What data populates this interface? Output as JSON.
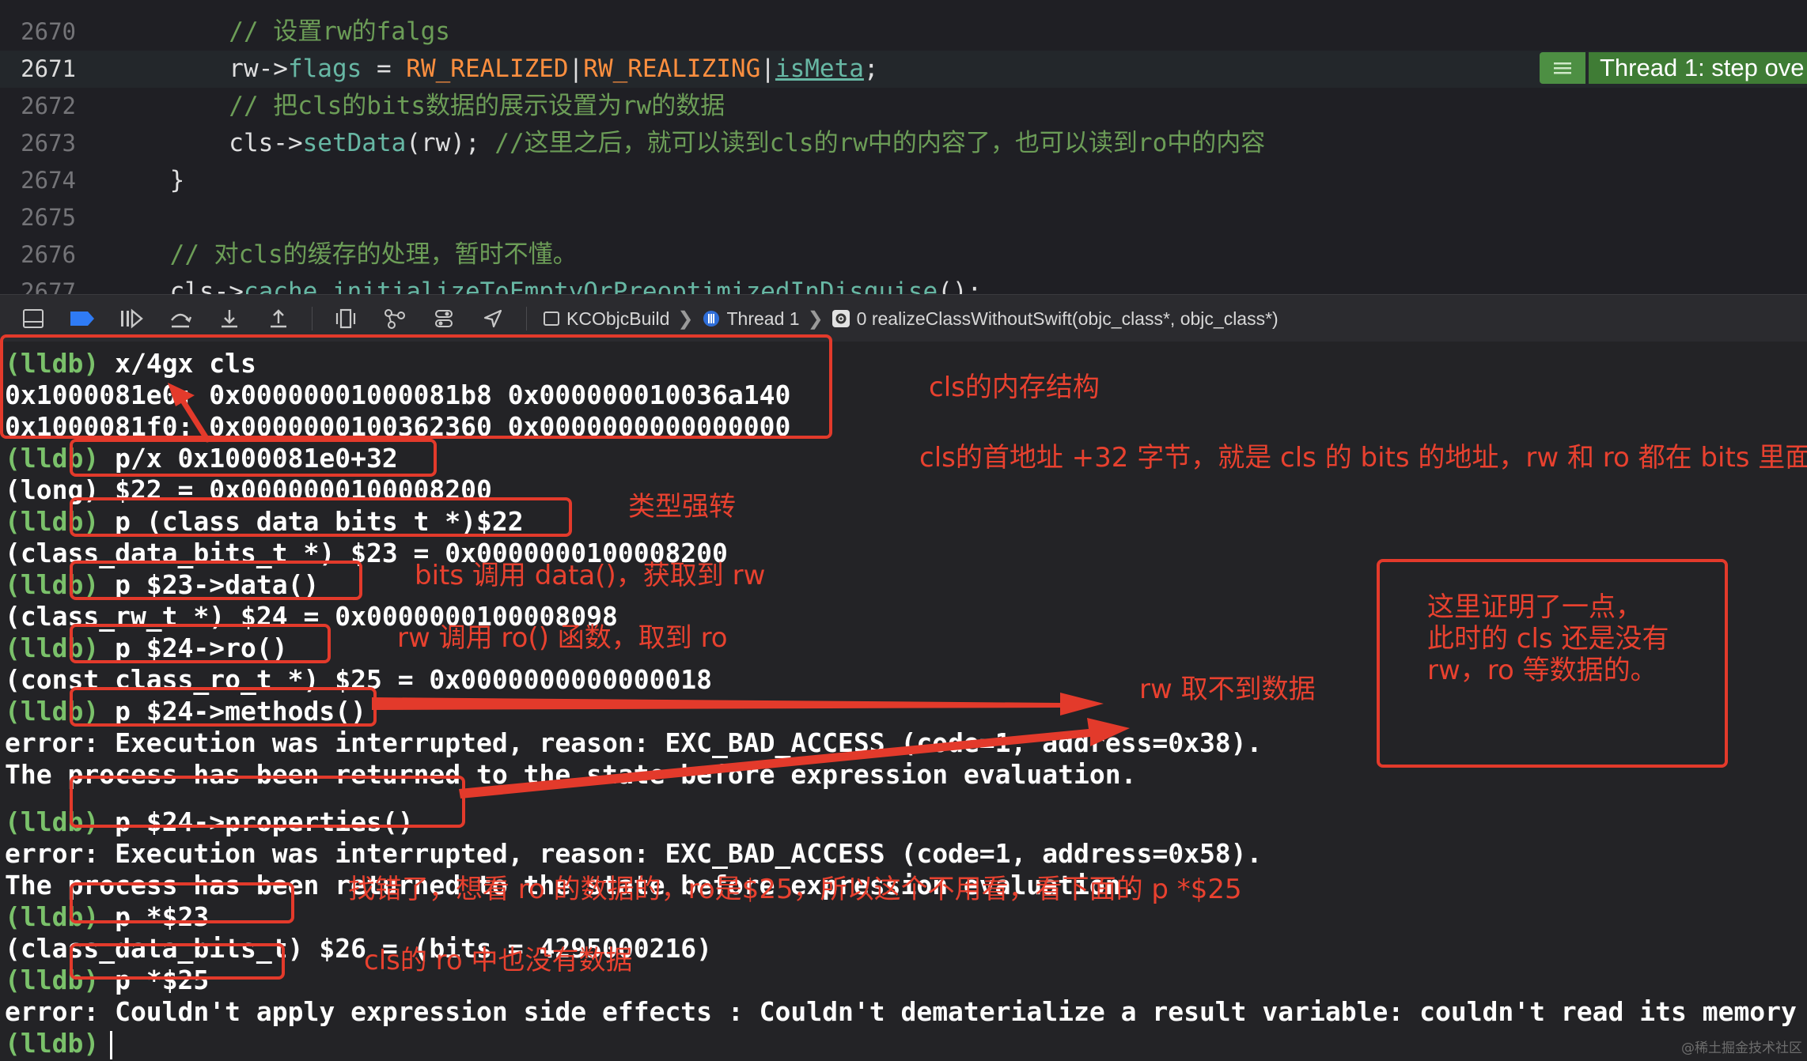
{
  "editor": {
    "lines": [
      {
        "num": "2670",
        "segments": [
          {
            "t": "        // 设置rw的falgs",
            "c": "cm"
          }
        ]
      },
      {
        "num": "2671",
        "current": true,
        "segments": [
          {
            "t": "        rw->",
            "c": ""
          },
          {
            "t": "flags",
            "c": "prop"
          },
          {
            "t": " = ",
            "c": ""
          },
          {
            "t": "RW_REALIZED",
            "c": "mac"
          },
          {
            "t": "|",
            "c": ""
          },
          {
            "t": "RW_REALIZING",
            "c": "mac"
          },
          {
            "t": "|",
            "c": ""
          },
          {
            "t": "isMeta",
            "c": "prop und"
          },
          {
            "t": ";",
            "c": ""
          }
        ]
      },
      {
        "num": "2672",
        "segments": [
          {
            "t": "        // 把cls的bits数据的展示设置为rw的数据",
            "c": "cm"
          }
        ]
      },
      {
        "num": "2673",
        "segments": [
          {
            "t": "        cls->",
            "c": ""
          },
          {
            "t": "setData",
            "c": "fn"
          },
          {
            "t": "(rw); ",
            "c": ""
          },
          {
            "t": "//这里之后，就可以读到cls的rw中的内容了，也可以读到ro中的内容",
            "c": "cm"
          }
        ]
      },
      {
        "num": "2674",
        "segments": [
          {
            "t": "    }",
            "c": ""
          }
        ]
      },
      {
        "num": "2675",
        "segments": []
      },
      {
        "num": "2676",
        "segments": [
          {
            "t": "    // 对cls的缓存的处理，暂时不懂。",
            "c": "cm"
          }
        ]
      },
      {
        "num": "2677",
        "segments": [
          {
            "t": "    cls->",
            "c": ""
          },
          {
            "t": "cache",
            "c": "prop"
          },
          {
            "t": ".",
            "c": ""
          },
          {
            "t": "initializeToEmptyOrPreoptimizedInDisguise",
            "c": "fn"
          },
          {
            "t": "();",
            "c": ""
          }
        ]
      }
    ],
    "thread_badge": "Thread 1: step ove"
  },
  "debug_bar": {
    "crumbs": [
      {
        "icon": "app-icon",
        "label": "KCObjcBuild"
      },
      {
        "icon": "thread-icon",
        "label": "Thread 1"
      },
      {
        "icon": "frame-gear-icon",
        "label": "0 realizeClassWithoutSwift(objc_class*, objc_class*)"
      }
    ]
  },
  "console": {
    "prompt": "(lldb)",
    "lines": [
      {
        "prompt": true,
        "text": " x/4gx cls"
      },
      {
        "prompt": false,
        "text": "0x1000081e0: 0x00000001000081b8 0x000000010036a140"
      },
      {
        "prompt": false,
        "text": "0x1000081f0: 0x0000000100362360 0x0000000000000000"
      },
      {
        "prompt": true,
        "text": " p/x 0x1000081e0+32"
      },
      {
        "prompt": false,
        "text": "(long) $22 = 0x0000000100008200"
      },
      {
        "prompt": true,
        "text": " p (class_data_bits_t *)$22"
      },
      {
        "prompt": false,
        "text": "(class_data_bits_t *) $23 = 0x0000000100008200"
      },
      {
        "prompt": true,
        "text": " p $23->data()"
      },
      {
        "prompt": false,
        "text": "(class_rw_t *) $24 = 0x0000000100008098"
      },
      {
        "prompt": true,
        "text": " p $24->ro()"
      },
      {
        "prompt": false,
        "text": "(const class_ro_t *) $25 = 0x0000000000000018"
      },
      {
        "prompt": true,
        "text": " p $24->methods()"
      },
      {
        "prompt": false,
        "text": "error: Execution was interrupted, reason: EXC_BAD_ACCESS (code=1, address=0x38)."
      },
      {
        "prompt": false,
        "text": "The process has been returned to the state before expression evaluation."
      },
      {
        "prompt": true,
        "text": " p $24->properties()"
      },
      {
        "prompt": false,
        "text": "error: Execution was interrupted, reason: EXC_BAD_ACCESS (code=1, address=0x58)."
      },
      {
        "prompt": false,
        "text": "The process has been returned to the state before expression evaluation."
      },
      {
        "prompt": true,
        "text": " p *$23"
      },
      {
        "prompt": false,
        "text": "(class_data_bits_t) $26 = (bits = 4295000216)"
      },
      {
        "prompt": true,
        "text": " p *$25"
      },
      {
        "prompt": false,
        "text": "error: Couldn't apply expression side effects : Couldn't dematerialize a result variable: couldn't read its memory"
      },
      {
        "prompt": true,
        "text": "",
        "cursor": true
      }
    ]
  },
  "annotations": {
    "memory": "cls的内存结构",
    "bits_addr": "cls的首地址 +32 字节，就是 cls 的 bits 的地址，rw 和 ro 都在 bits 里面",
    "cast": "类型强转",
    "data_call": "bits 调用 data()，获取到 rw",
    "ro_call": "rw 调用 ro() 函数，取到 ro",
    "no_data": "rw 取不到数据",
    "proof": "这里证明了一点，\n此时的 cls 还是没有\nrw，ro 等数据的。",
    "wrong": "找错了，想看 ro 的数据的，ro是$25，所以这个不用看，看下面的 p *$25",
    "ro_empty": "cls的 ro 中也没有数据"
  },
  "watermark": "@稀土掘金技术社区",
  "colors": {
    "annotation_red": "#e33a2b",
    "prompt_green": "#7ac16a",
    "badge_green": "#3f7c35"
  }
}
